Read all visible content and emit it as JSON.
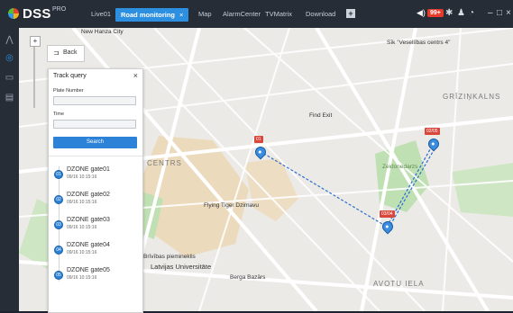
{
  "brand": {
    "name": "DSS",
    "suffix": "PRO"
  },
  "tabs": [
    "Live01",
    "Road monitoring",
    "Map",
    "AlarmCenter",
    "TVMatrix",
    "Download"
  ],
  "alarm_count": "99+",
  "back_label": "Back",
  "panel": {
    "title": "Track query",
    "plate_label": "Plate Number",
    "time_label": "Time",
    "plate_value": "",
    "time_value": "",
    "search_label": "Search"
  },
  "gates": [
    {
      "num": "01",
      "name": "DZONE gate01",
      "time": "09/16 10:15:16"
    },
    {
      "num": "02",
      "name": "DZONE gate02",
      "time": "09/16 10:15:16"
    },
    {
      "num": "03",
      "name": "DZONE gate03",
      "time": "09/16 10:15:16"
    },
    {
      "num": "04",
      "name": "DZONE gate04",
      "time": "09/16 10:15:16"
    },
    {
      "num": "05",
      "name": "DZONE gate05",
      "time": "09/16 10:15:16"
    }
  ],
  "map": {
    "labels": [
      "New Hanza City",
      "Sīk \"Vesellības centrs 4\"",
      "GRĪZIŅKALNS",
      "Find Exit",
      "CENTRS",
      "Zeidonedarzs",
      "Flying Tiger Dzirnavu",
      "Brīvības piemineklis",
      "Latvijas Universitāte",
      "Berga Bazārs",
      "AVOTU IELA"
    ],
    "markers": [
      "01",
      "03/04",
      "02/05"
    ]
  },
  "colors": {
    "accent": "#2c8fe0",
    "alarm": "#e53b2c",
    "topbar": "#272d36"
  }
}
